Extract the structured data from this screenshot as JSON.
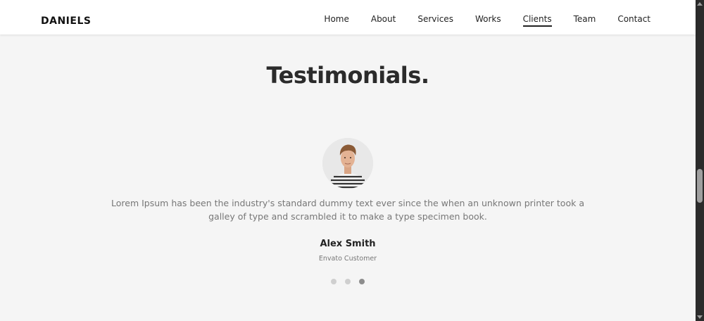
{
  "header": {
    "brand": "DANIELS",
    "nav": [
      "Home",
      "About",
      "Services",
      "Works",
      "Clients",
      "Team",
      "Contact"
    ],
    "active_nav": "Clients"
  },
  "testimonials": {
    "title": "Testimonials.",
    "quote": "Lorem Ipsum has been the industry's standard dummy text ever since the when an unknown printer took a galley of type and scrambled it to make a type specimen book.",
    "author_name": "Alex Smith",
    "author_role": "Envato Customer",
    "slide_count": 3,
    "active_slide": 3
  },
  "colors": {
    "background": "#f5f5f5",
    "header_bg": "#ffffff",
    "title": "#2b2b2b",
    "body_text": "#777777",
    "dot_inactive": "#cfcfcf",
    "dot_active": "#8d8d8d"
  }
}
